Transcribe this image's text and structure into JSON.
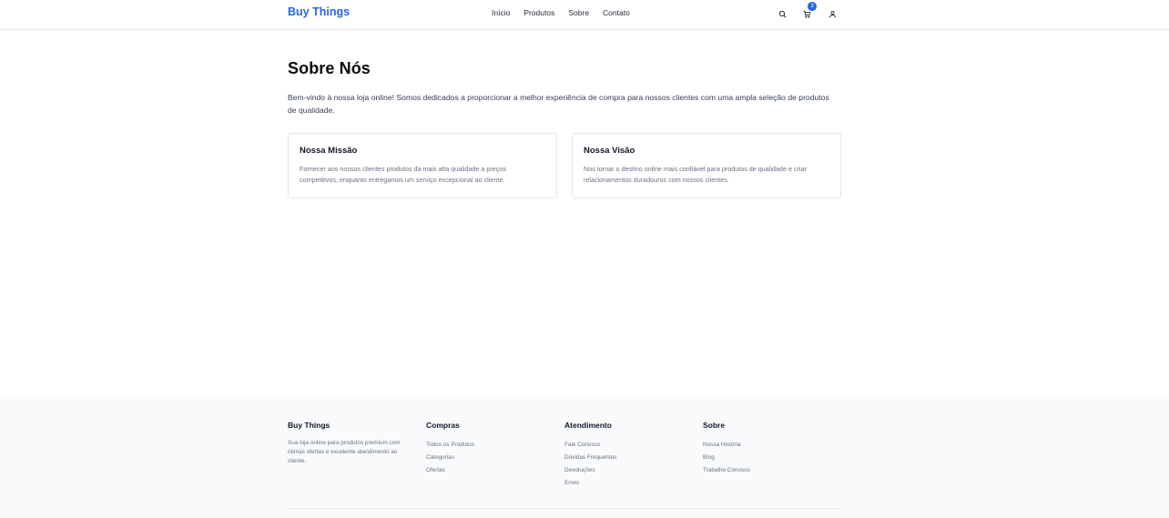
{
  "header": {
    "brand": "Buy Things",
    "nav": [
      {
        "label": "Início"
      },
      {
        "label": "Produtos"
      },
      {
        "label": "Sobre"
      },
      {
        "label": "Contato"
      }
    ],
    "icons": {
      "search": "search-icon",
      "cart": "cart-icon",
      "user": "user-icon"
    },
    "cart_count": "3"
  },
  "main": {
    "title": "Sobre Nós",
    "intro": "Bem-vindo à nossa loja online! Somos dedicados a proporcionar a melhor experiência de compra para nossos clientes com uma ampla seleção de produtos de qualidade.",
    "cards": [
      {
        "title": "Nossa Missão",
        "text": "Fornecer aos nossos clientes produtos da mais alta qualidade a preços competitivos, enquanto entregamos um serviço excepcional ao cliente."
      },
      {
        "title": "Nossa Visão",
        "text": "Nos tornar o destino online mais confiável para produtos de qualidade e criar relacionamentos duradouros com nossos clientes."
      }
    ]
  },
  "footer": {
    "about": {
      "title": "Buy Things",
      "text": "Sua loja online para produtos premium com ótimas ofertas e excelente atendimento ao cliente."
    },
    "columns": [
      {
        "title": "Compras",
        "links": [
          "Todos os Produtos",
          "Categorias",
          "Ofertas"
        ]
      },
      {
        "title": "Atendimento",
        "links": [
          "Fale Conosco",
          "Dúvidas Frequentes",
          "Devoluções",
          "Envio"
        ]
      },
      {
        "title": "Sobre",
        "links": [
          "Nossa História",
          "Blog",
          "Trabalhe Conosco"
        ]
      }
    ]
  },
  "colors": {
    "brand": "#2563eb",
    "text": "#111827",
    "muted": "#6b7280",
    "border": "#e5e7eb",
    "footer_bg": "#f9fafb"
  }
}
